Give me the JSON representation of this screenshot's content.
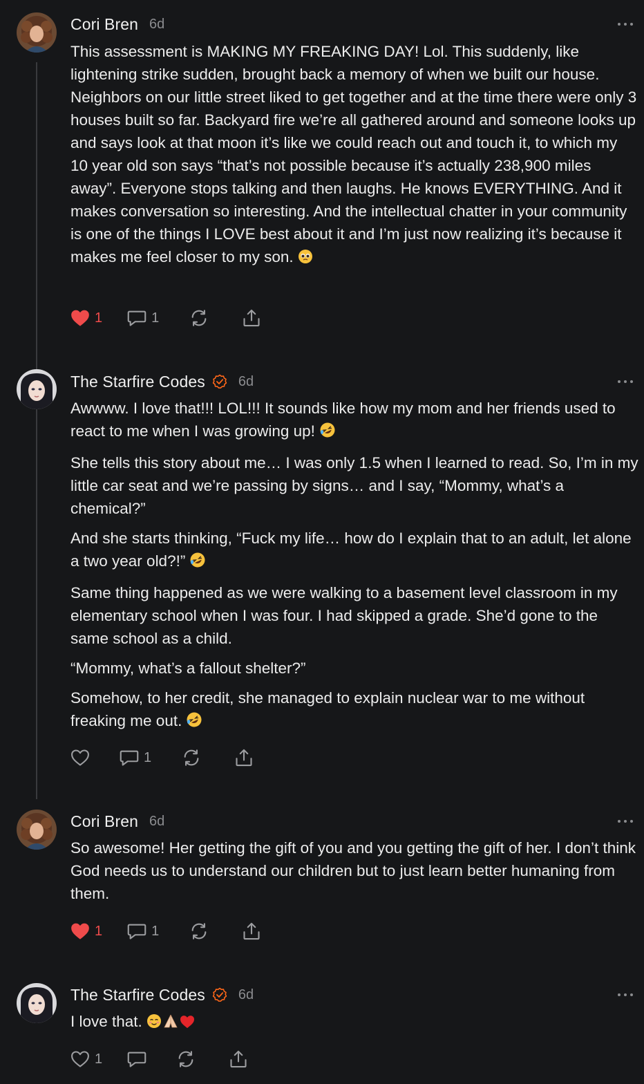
{
  "comments": [
    {
      "author": "Cori Bren",
      "time": "6d",
      "verified": false,
      "avatar_icon": "curly-hair-woman-avatar",
      "paragraphs": [
        "This assessment is MAKING MY FREAKING DAY! Lol. This suddenly, like lightening strike sudden, brought back a memory of when we built our house. Neighbors on our little street liked to get together and at the time there were only 3 houses built so far. Backyard fire we’re all gathered around and someone looks up and says look at that moon it’s like we could reach out and touch it, to which my 10 year old son says “that’s not possible because it’s actually 238,900 miles away”. Everyone stops talking and then laughs. He knows EVERYTHING. And it makes conversation so interesting. And the intellectual chatter in your community is one of the things I LOVE best about it and I’m just now realizing it’s because it makes me feel closer to my son."
      ],
      "emoji_tail": [
        "pleading-face-emoji"
      ],
      "liked": true,
      "like_count": "1",
      "reply_count": "1"
    },
    {
      "author": "The Starfire Codes",
      "time": "6d",
      "verified": true,
      "avatar_icon": "dark-hair-woman-avatar",
      "paragraphs": [
        "Awwww. I love that!!! LOL!!! It sounds like how my mom and her friends used to react to me when I was growing up!",
        "She tells this story about me… I was only 1.5 when I learned to read. So, I’m in my little car seat and we’re passing by signs… and I say, “Mommy, what’s a chemical?”",
        "And she starts thinking, “Fuck my life… how do I explain that to an adult, let alone a two year old?!”",
        "Same thing happened as we were walking to a basement level classroom in my elementary school when I was four. I had skipped a grade. She’d gone to the same school as a child.",
        "“Mommy, what’s a fallout shelter?”",
        "Somehow, to her credit, she managed to explain nuclear war to me without freaking me out."
      ],
      "liked": false,
      "like_count": "",
      "reply_count": "1"
    },
    {
      "author": "Cori Bren",
      "time": "6d",
      "verified": false,
      "avatar_icon": "curly-hair-woman-avatar",
      "paragraphs": [
        "So awesome! Her getting the gift of you and you getting the gift of her. I don’t think God needs us to understand our children but to just learn better humaning from them."
      ],
      "liked": true,
      "like_count": "1",
      "reply_count": "1"
    },
    {
      "author": "The Starfire Codes",
      "time": "6d",
      "verified": true,
      "avatar_icon": "dark-hair-woman-avatar",
      "paragraphs": [
        "I love that."
      ],
      "emoji_tail": [
        "smiling-face-emoji",
        "folded-hands-emoji",
        "red-heart-emoji"
      ],
      "liked": false,
      "like_count": "1",
      "reply_count": ""
    }
  ],
  "icons": {
    "like": "heart-icon",
    "reply": "speech-bubble-icon",
    "restack": "restack-icon",
    "share": "share-icon",
    "more": "ellipsis-icon",
    "verified": "verified-check-icon"
  },
  "colors": {
    "background": "#161719",
    "liked_heart": "#ef4b4b",
    "verified_badge": "#ff6719",
    "muted_text": "#8b8c8f"
  }
}
